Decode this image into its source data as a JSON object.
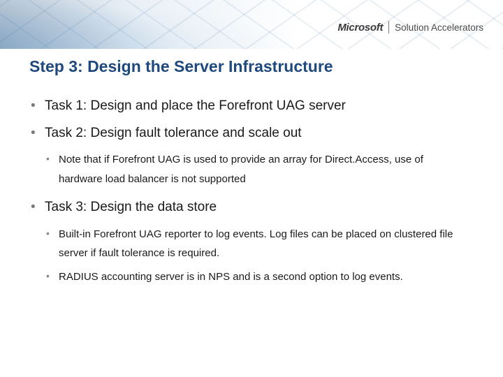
{
  "brand": {
    "company": "Microsoft",
    "product": "Solution Accelerators"
  },
  "title": "Step 3: Design the Server Infrastructure",
  "bullets": [
    {
      "text": "Task 1: Design and place the Forefront UAG server",
      "sub": []
    },
    {
      "text": "Task 2: Design fault tolerance and scale out",
      "sub": [
        "Note that if Forefront UAG is used to provide an array for Direct.Access, use of hardware load balancer is not supported"
      ]
    },
    {
      "text": "Task 3: Design the data store",
      "sub": [
        "Built-in Forefront UAG reporter to log events. Log files can be placed on clustered file server if fault tolerance is required.",
        "RADIUS accounting server is in NPS and is a second option to log events."
      ]
    }
  ]
}
